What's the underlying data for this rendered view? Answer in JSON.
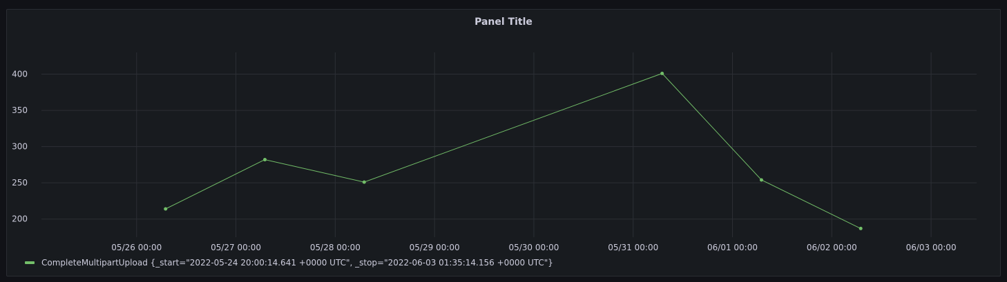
{
  "panel": {
    "title": "Panel Title"
  },
  "colors": {
    "series": "#73bf69",
    "grid": "#2c2f35",
    "text": "#ccccdc",
    "panel_bg": "#181b1f"
  },
  "chart_data": {
    "type": "line",
    "title": "Panel Title",
    "xlabel": "",
    "ylabel": "",
    "x_ticks": [
      "05/26 00:00",
      "05/27 00:00",
      "05/28 00:00",
      "05/29 00:00",
      "05/30 00:00",
      "05/31 00:00",
      "06/01 00:00",
      "06/02 00:00",
      "06/03 00:00"
    ],
    "y_ticks": [
      200,
      250,
      300,
      350,
      400
    ],
    "xlim": [
      "2022-05-25 01:00",
      "2022-06-03 11:00"
    ],
    "ylim": [
      175,
      430
    ],
    "grid": true,
    "legend_position": "bottom-left",
    "series": [
      {
        "name": "CompleteMultipartUpload {_start=\"2022-05-24 20:00:14.641 +0000 UTC\", _stop=\"2022-06-03 01:35:14.156 +0000 UTC\"}",
        "color": "#73bf69",
        "x": [
          "2022-05-26 07:00",
          "2022-05-27 07:00",
          "2022-05-28 07:00",
          "2022-05-31 07:00",
          "2022-06-01 07:00",
          "2022-06-02 07:00"
        ],
        "y": [
          214,
          282,
          251,
          401,
          254,
          187
        ]
      }
    ]
  }
}
